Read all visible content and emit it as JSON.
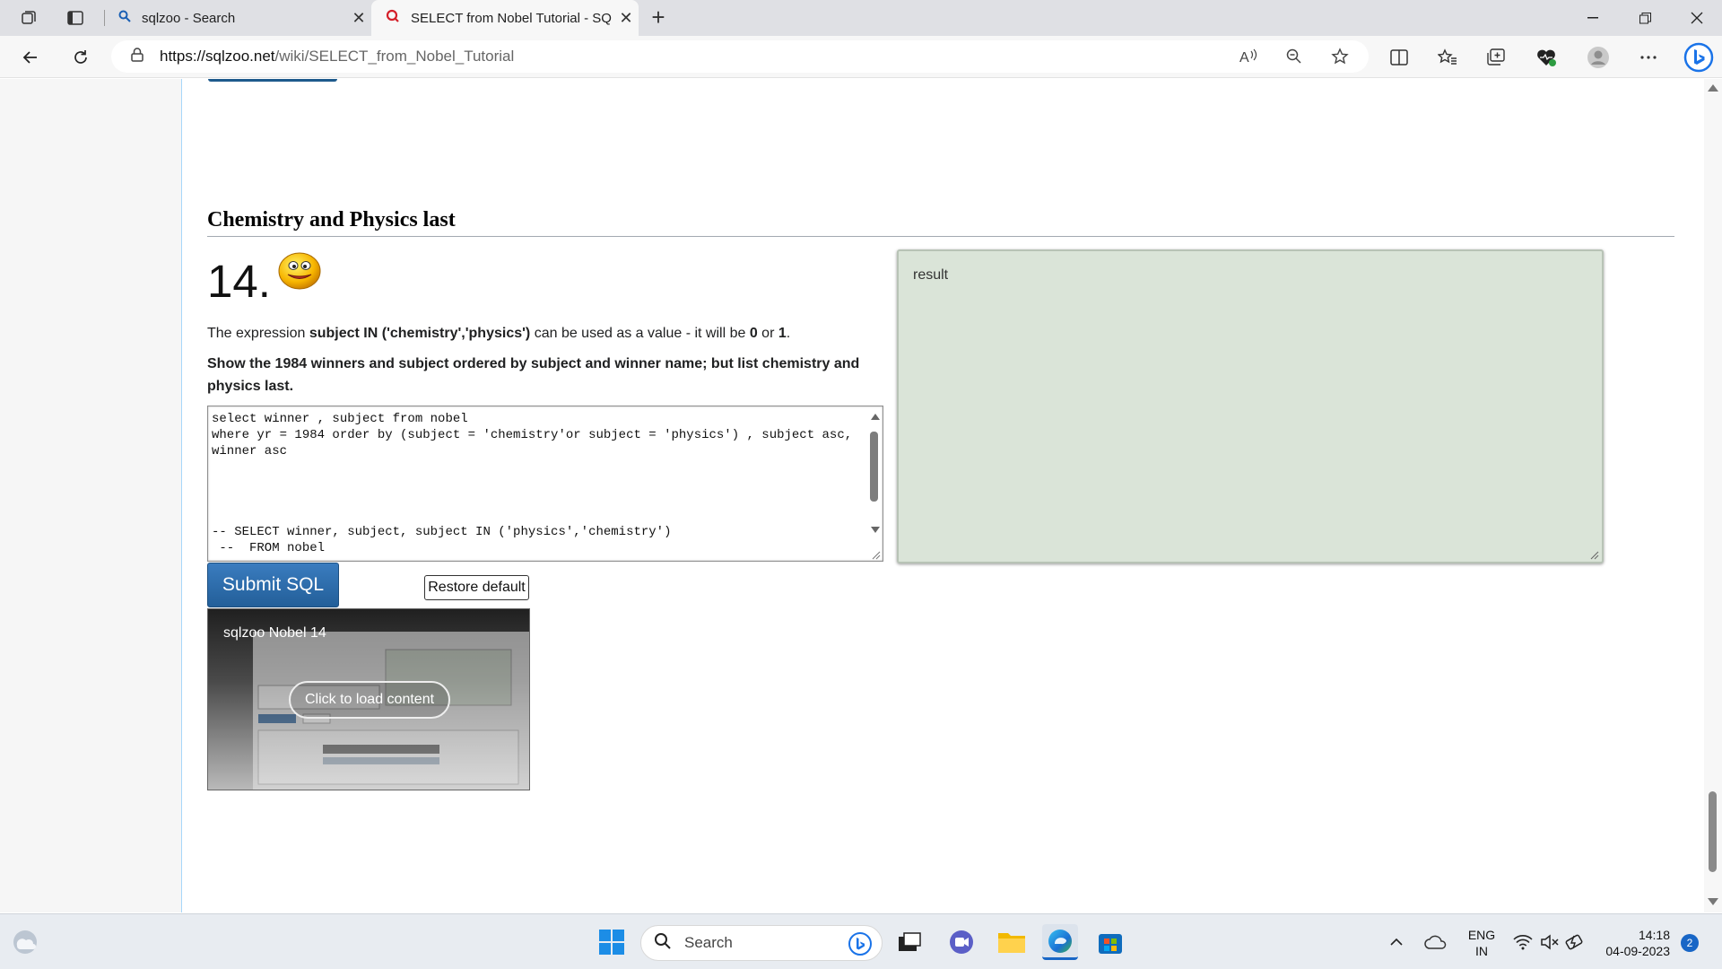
{
  "browser": {
    "tabs": [
      {
        "title": "sqlzoo - Search"
      },
      {
        "title": "SELECT from Nobel Tutorial - SQ"
      }
    ],
    "address": {
      "host": "https://sqlzoo.net",
      "path": "/wiki/SELECT_from_Nobel_Tutorial"
    }
  },
  "page": {
    "section_heading": "Chemistry and Physics last",
    "question_number": "14.",
    "expression": {
      "prefix": "The expression ",
      "code": "subject IN ('chemistry','physics')",
      "middle": " can be used as a value - it will be ",
      "v0": "0",
      "or": " or ",
      "v1": "1",
      "end": "."
    },
    "task": "Show the 1984 winners and subject ordered by subject and winner name; but list chemistry and physics last.",
    "editor_code": "select winner , subject from nobel\nwhere yr = 1984 order by (subject = 'chemistry'or subject = 'physics') , subject asc,\nwinner asc\n\n\n\n\n-- SELECT winner, subject, subject IN ('physics','chemistry')\n --  FROM nobel",
    "result_label": "result",
    "submit_label": "Submit SQL",
    "restore_label": "Restore default",
    "video": {
      "title": "sqlzoo Nobel 14",
      "load_label": "Click to load content"
    }
  },
  "taskbar": {
    "search_label": "Search",
    "lang_line1": "ENG",
    "lang_line2": "IN",
    "time": "14:18",
    "date": "04-09-2023",
    "notifications": "2"
  },
  "colors": {
    "accent": "#235f99",
    "result_bg": "#dae4d8",
    "edge_blue": "#1866c6"
  }
}
